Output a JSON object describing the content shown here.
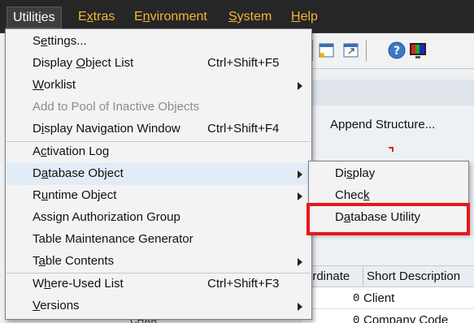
{
  "menubar": {
    "items": [
      {
        "pre": "Utilit",
        "acc": "i",
        "post": "es",
        "active": true
      },
      {
        "pre": "E",
        "acc": "x",
        "post": "tras"
      },
      {
        "pre": "E",
        "acc": "n",
        "post": "vironment"
      },
      {
        "pre": "",
        "acc": "S",
        "post": "ystem"
      },
      {
        "pre": "",
        "acc": "H",
        "post": "elp"
      }
    ]
  },
  "menu": {
    "items": [
      {
        "pre": "S",
        "acc": "e",
        "post": "ttings...",
        "shortcut": ""
      },
      {
        "pre": "Display ",
        "acc": "O",
        "post": "bject List",
        "shortcut": "Ctrl+Shift+F5"
      },
      {
        "pre": "",
        "acc": "W",
        "post": "orklist",
        "shortcut": "",
        "submenu": true
      },
      {
        "pre": "Add to Pool of Inactive Objects",
        "acc": "",
        "post": "",
        "shortcut": "",
        "disabled": true
      },
      {
        "pre": "D",
        "acc": "i",
        "post": "splay Navigation Window",
        "shortcut": "Ctrl+Shift+F4"
      },
      {
        "pre": "A",
        "acc": "c",
        "post": "tivation Log",
        "shortcut": ""
      },
      {
        "pre": "D",
        "acc": "a",
        "post": "tabase Object",
        "shortcut": "",
        "submenu": true,
        "highlighted": true
      },
      {
        "pre": "R",
        "acc": "u",
        "post": "ntime Object",
        "shortcut": "",
        "submenu": true
      },
      {
        "pre": "Assi",
        "acc": "g",
        "post": "n Authorization Group",
        "shortcut": ""
      },
      {
        "pre": "Table Maintenance Generator",
        "acc": "",
        "post": "",
        "shortcut": ""
      },
      {
        "pre": "T",
        "acc": "a",
        "post": "ble Contents",
        "shortcut": "",
        "submenu": true
      },
      {
        "pre": "W",
        "acc": "h",
        "post": "ere-Used List",
        "shortcut": "Ctrl+Shift+F3"
      },
      {
        "pre": "",
        "acc": "V",
        "post": "ersions",
        "shortcut": "",
        "submenu": true
      }
    ]
  },
  "submenu": {
    "items": [
      {
        "pre": "Di",
        "acc": "s",
        "post": "play"
      },
      {
        "pre": "Chec",
        "acc": "k",
        "post": ""
      },
      {
        "pre": "D",
        "acc": "a",
        "post": "tabase Utility"
      }
    ]
  },
  "background": {
    "append_structure": "Append Structure...",
    "col_coordinate": "ordinate",
    "col_short_description": "Short Description",
    "rows": [
      {
        "num": "0",
        "desc": "Client"
      },
      {
        "num": "0",
        "desc": "Company Code"
      }
    ],
    "bottom_fragment": "CHAR"
  },
  "colors": {
    "menubar_bg": "#262626",
    "menubar_text": "#f5b53a",
    "highlight_row": "#e2ecf6",
    "annotation_red": "#e8161c"
  },
  "icons": [
    "save-icon",
    "open-icon",
    "help-icon",
    "monitor-icon"
  ]
}
